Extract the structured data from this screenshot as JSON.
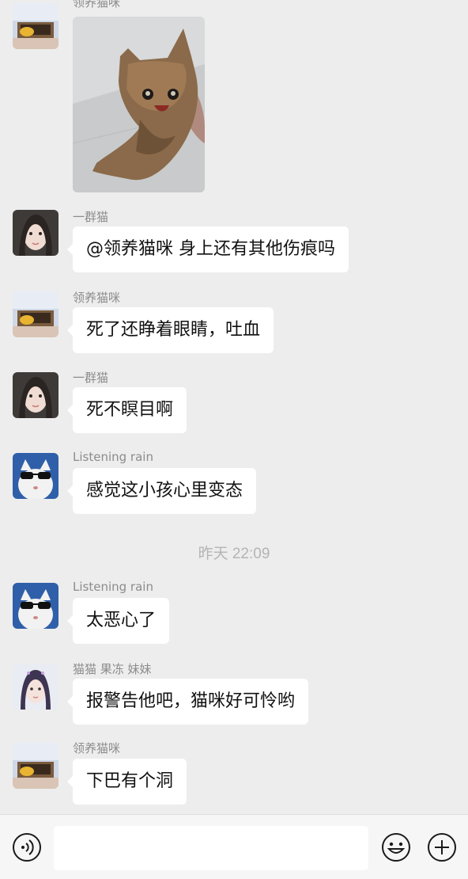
{
  "messages": [
    {
      "sender": "领养猫咪",
      "type": "image"
    },
    {
      "sender": "一群猫",
      "text": "@领养猫咪 身上还有其他伤痕吗"
    },
    {
      "sender": "领养猫咪",
      "text": "死了还睁着眼睛，吐血"
    },
    {
      "sender": "一群猫",
      "text": "死不瞑目啊"
    },
    {
      "sender": "Listening rain",
      "text": "感觉这小孩心里变态"
    },
    {
      "sender": "Listening rain",
      "text": "太恶心了"
    },
    {
      "sender": "猫猫   果冻   妹妹",
      "text": "报警告他吧，猫咪好可怜哟"
    },
    {
      "sender": "领养猫咪",
      "text": "下巴有个洞"
    }
  ],
  "timestamp": "昨天 22:09",
  "icons": {
    "voice": "voice-icon",
    "emoji": "emoji-icon",
    "plus": "plus-icon"
  },
  "colors": {
    "background": "#ededed",
    "bubble": "#ffffff",
    "sender": "#8c8c8c"
  }
}
